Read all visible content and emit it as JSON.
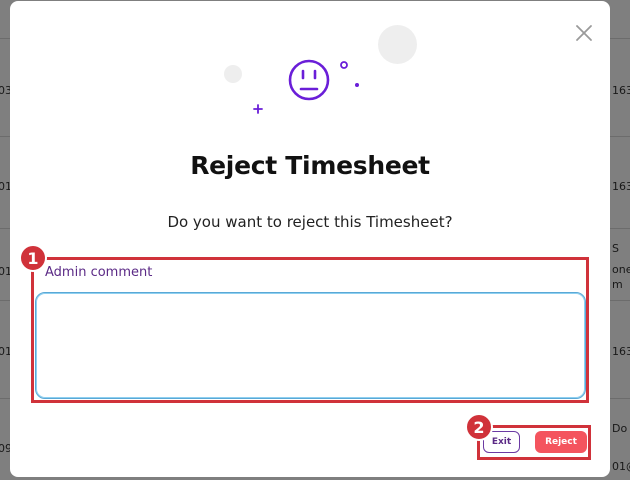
{
  "background": {
    "left_fragments": [
      "03",
      "01",
      "01",
      "01",
      "09"
    ],
    "right_fragments": [
      "163",
      "163",
      "S",
      "one",
      "m",
      "163",
      "Do n",
      "01@"
    ]
  },
  "dialog": {
    "title": "Reject Timesheet",
    "message": "Do you want to reject this Timesheet?",
    "comment_label": "Admin comment",
    "comment_value": "",
    "exit_label": "Exit",
    "reject_label": "Reject",
    "icon": "neutral-face-icon",
    "close_icon": "close-icon"
  },
  "annotations": {
    "badge_1": "1",
    "badge_2": "2"
  },
  "colors": {
    "accent_purple": "#6a1ed8",
    "reject_red": "#f4545e",
    "annotation_red": "#d0323a"
  }
}
